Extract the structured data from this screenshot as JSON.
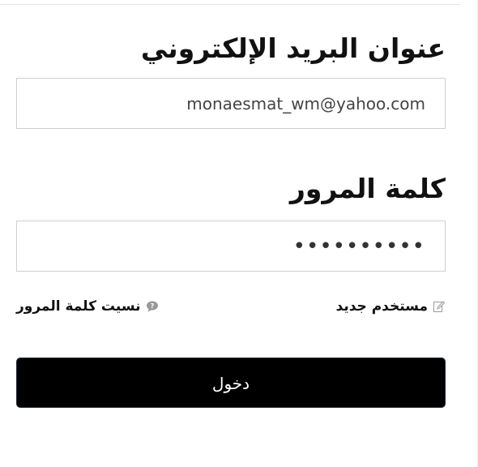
{
  "form": {
    "email_label": "عنوان البريد الإلكتروني",
    "email_value": "monaesmat_wm@yahoo.com",
    "password_label": "كلمة المرور",
    "password_value": "••••••••••",
    "new_user_link": "مستخدم جديد",
    "new_user_icon": "edit-icon",
    "forgot_password_link": "نسيت كلمة المرور",
    "forgot_password_icon": "speech-bubble-icon",
    "login_button": "دخول"
  },
  "colors": {
    "button_background": "#000000",
    "button_text": "#ffffff",
    "input_border": "#cfcfcf",
    "icon_gray": "#999999"
  }
}
